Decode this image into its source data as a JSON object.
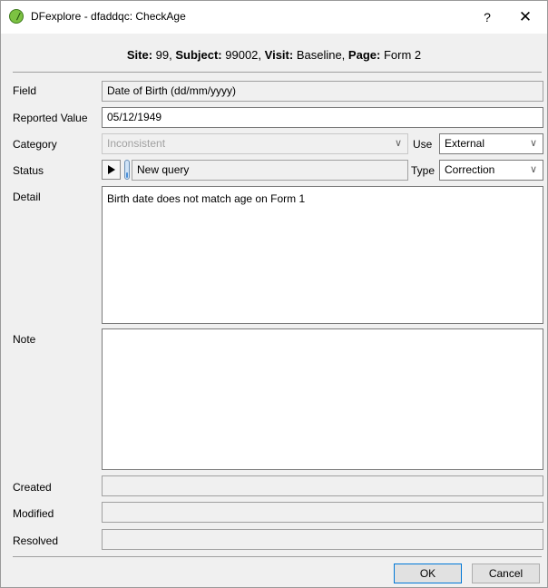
{
  "window": {
    "title": "DFexplore - dfaddqc: CheckAge",
    "help_label": "?",
    "close_label": "✕"
  },
  "header": {
    "site_label": "Site:",
    "site_value": " 99,",
    "subject_label": "Subject:",
    "subject_value": " 99002,",
    "visit_label": "Visit:",
    "visit_value": " Baseline,",
    "page_label": "Page:",
    "page_value": " Form 2"
  },
  "form": {
    "field_label": "Field",
    "field_value": "Date of Birth (dd/mm/yyyy)",
    "reported_label": "Reported Value",
    "reported_value": "05/12/1949",
    "category_label": "Category",
    "category_value": "Inconsistent",
    "use_label": "Use",
    "use_value": "External",
    "status_label": "Status",
    "status_value": "New query",
    "type_label": "Type",
    "type_value": "Correction",
    "detail_label": "Detail",
    "detail_value": "Birth date does not match age on Form 1",
    "note_label": "Note",
    "note_value": "",
    "created_label": "Created",
    "created_value": "",
    "modified_label": "Modified",
    "modified_value": "",
    "resolved_label": "Resolved",
    "resolved_value": ""
  },
  "buttons": {
    "ok_label": "OK",
    "cancel_label": "Cancel"
  },
  "icons": {
    "app": "dfexplore-app-icon",
    "dropdown": "chevron-down-icon",
    "play": "play-icon",
    "status": "thermometer-icon"
  },
  "colors": {
    "default_button_border": "#0078d7",
    "app_icon": "#7cc242"
  }
}
